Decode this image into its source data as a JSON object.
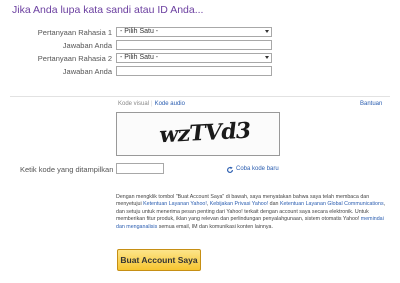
{
  "heading": "Jika Anda lupa kata sandi atau ID Anda...",
  "questions": {
    "q1_label": "Pertanyaan Rahasia 1",
    "q1_selected": "- Pilih Satu -",
    "a1_label": "Jawaban Anda",
    "q2_label": "Pertanyaan Rahasia 2",
    "q2_selected": "- Pilih Satu -",
    "a2_label": "Jawaban Anda"
  },
  "captcha": {
    "tab_visual": "Kode visual",
    "tab_separator": "|",
    "tab_audio": "Kode audio",
    "help": "Bantuan",
    "code_text": "wzTVd3",
    "input_label": "Ketik kode yang ditampilkan",
    "refresh": "Coba kode baru"
  },
  "terms": {
    "t1": "Dengan mengklik tombol \"Buat Account Saya\" di bawah, saya menyatakan bahwa saya telah membaca dan menyetujui ",
    "link1": "Ketentuan Layanan Yahoo!",
    "t2": ", ",
    "link2": "Kebijakan Privasi Yahoo!",
    "t3": " dan ",
    "link3": "Ketentuan Layanan Global Communications",
    "t4": ", dan setuju untuk menerima pesan penting dari Yahoo! terkait dengan account saya secara elektronik. Untuk memberikan fitur produk, iklan yang relevan dan perlindungan penyalahgunaan, sistem otomatis Yahoo! ",
    "link4": "memindai dan menganalisis",
    "t5": " semua email, IM dan komunikasi konten lainnya."
  },
  "submit_label": "Buat Account Saya",
  "colors": {
    "heading": "#6b3fa0",
    "link": "#2a5db0",
    "button_top": "#fde58a",
    "button_bottom": "#f6c531"
  }
}
